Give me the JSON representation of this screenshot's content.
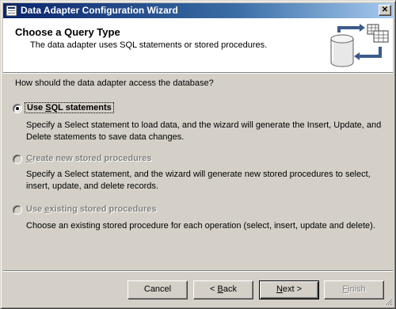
{
  "window": {
    "title": "Data Adapter Configuration Wizard",
    "close_glyph": "✕"
  },
  "header": {
    "title": "Choose a Query Type",
    "subtitle": "The data adapter uses SQL statements or stored procedures."
  },
  "question": "How should the data adapter access the database?",
  "options": [
    {
      "label_before": "Use ",
      "label_underlined": "S",
      "label_after": "QL statements",
      "selected": true,
      "enabled": true,
      "description": "Specify a Select statement to load data, and the wizard will generate the Insert, Update, and Delete statements to save data changes."
    },
    {
      "label_before": "",
      "label_underlined": "C",
      "label_after": "reate new stored procedures",
      "selected": false,
      "enabled": false,
      "description": "Specify a Select statement, and the wizard will generate new stored procedures to select, insert, update, and delete records."
    },
    {
      "label_before": "Use ",
      "label_underlined": "e",
      "label_after": "xisting stored procedures",
      "selected": false,
      "enabled": false,
      "description": "Choose an existing stored procedure for each operation (select, insert, update and delete)."
    }
  ],
  "buttons": {
    "cancel": "Cancel",
    "back_prefix": "< ",
    "back_underlined": "B",
    "back_rest": "ack",
    "next_underlined": "N",
    "next_rest": "ext >",
    "finish_underlined": "F",
    "finish_rest": "inish"
  },
  "icons": {
    "title": "wizard-app-icon",
    "header_graphic": "database-sync-icon",
    "resize": "size-grip-icon"
  }
}
